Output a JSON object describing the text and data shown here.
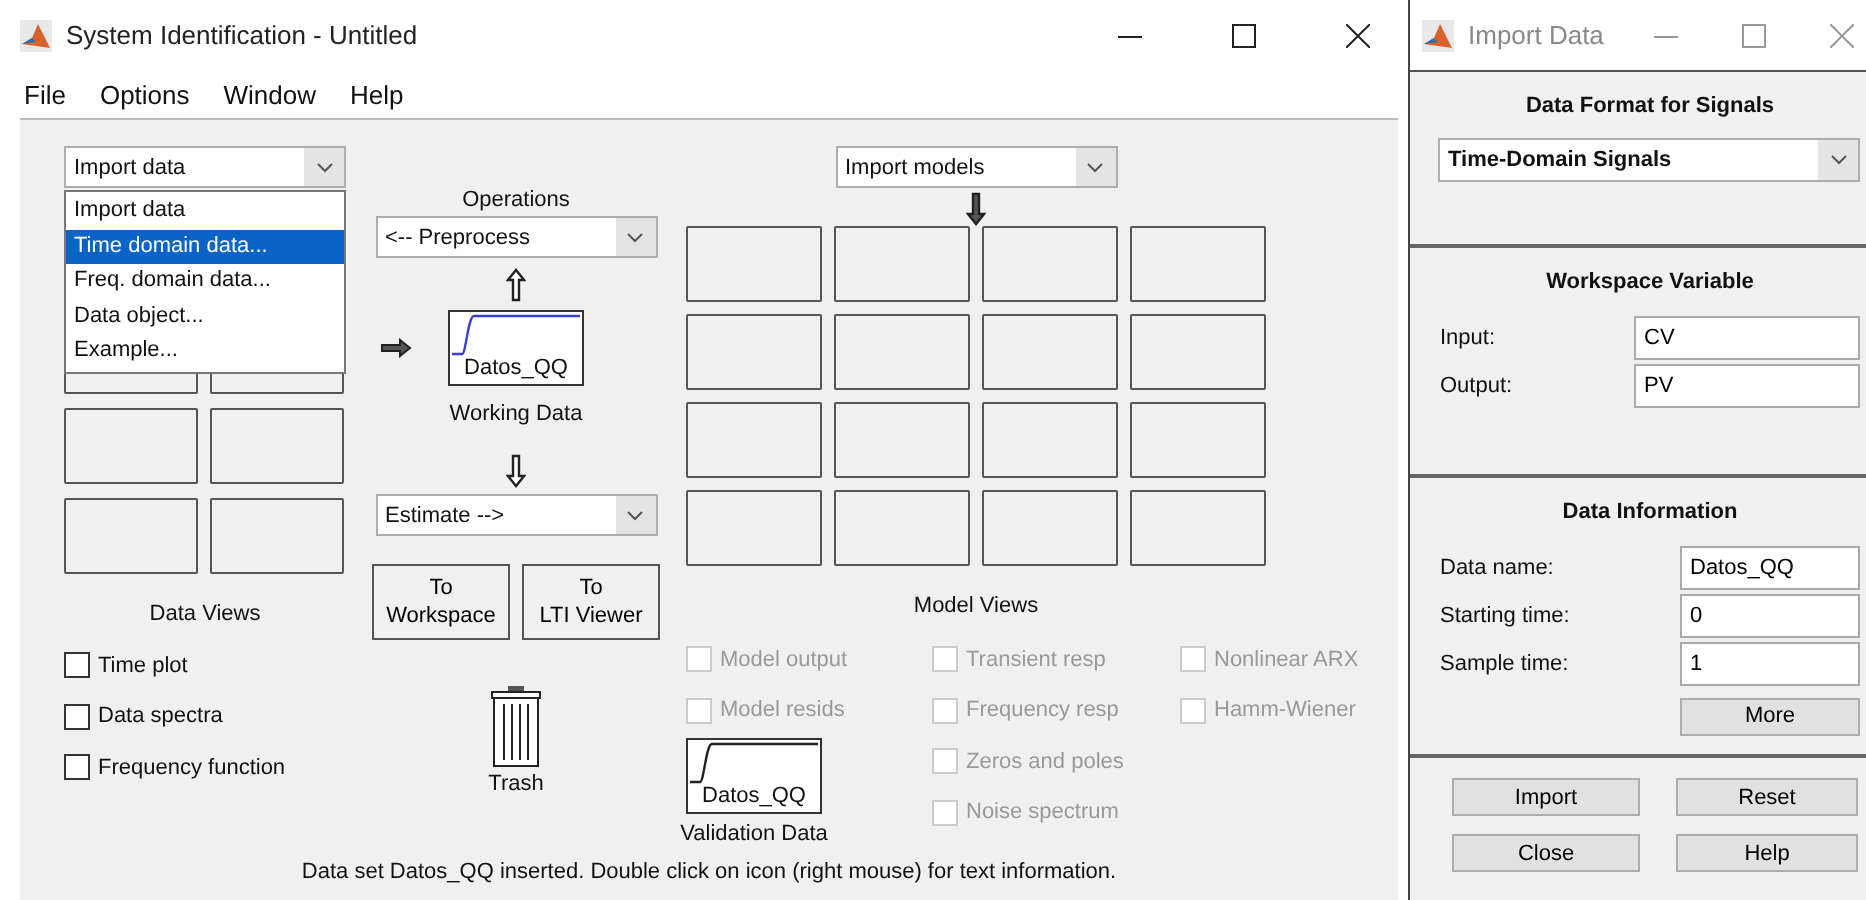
{
  "window": {
    "title": "System Identification - Untitled"
  },
  "menu": [
    "File",
    "Options",
    "Window",
    "Help"
  ],
  "data_views": {
    "dropdown": "Import data",
    "dropdown_menu": [
      {
        "label": "Import data",
        "selected": false
      },
      {
        "label": "Time domain data...",
        "selected": true
      },
      {
        "label": "Freq. domain data...",
        "selected": false
      },
      {
        "label": "Data object...",
        "selected": false
      },
      {
        "label": "Example...",
        "selected": false
      }
    ],
    "title": "Data Views",
    "checkboxes": [
      {
        "label": "Time plot",
        "checked": false,
        "disabled": false
      },
      {
        "label": "Data spectra",
        "checked": false,
        "disabled": false
      },
      {
        "label": "Frequency function",
        "checked": false,
        "disabled": false
      }
    ]
  },
  "operations": {
    "title": "Operations",
    "preprocess": "<-- Preprocess",
    "working_data": {
      "name": "Datos_QQ",
      "label": "Working Data"
    },
    "estimate": "Estimate -->",
    "buttons": [
      {
        "lines": [
          "To",
          "Workspace"
        ]
      },
      {
        "lines": [
          "To",
          "LTI Viewer"
        ]
      }
    ],
    "trash": "Trash"
  },
  "model_views": {
    "dropdown": "Import models",
    "title": "Model Views",
    "checkbox_columns": [
      [
        {
          "label": "Model output",
          "checked": false,
          "disabled": true
        },
        {
          "label": "Model resids",
          "checked": false,
          "disabled": true
        }
      ],
      [
        {
          "label": "Transient resp",
          "checked": false,
          "disabled": true
        },
        {
          "label": "Frequency resp",
          "checked": false,
          "disabled": true
        },
        {
          "label": "Zeros and poles",
          "checked": false,
          "disabled": true
        },
        {
          "label": "Noise spectrum",
          "checked": false,
          "disabled": true
        }
      ],
      [
        {
          "label": "Nonlinear ARX",
          "checked": false,
          "disabled": true
        },
        {
          "label": "Hamm-Wiener",
          "checked": false,
          "disabled": true
        }
      ]
    ],
    "validation_data": {
      "name": "Datos_QQ",
      "label": "Validation Data"
    }
  },
  "status_bar": "Data set Datos_QQ inserted.  Double click on icon (right mouse) for text information.",
  "import_dialog": {
    "title": "Import Data",
    "format": {
      "heading": "Data Format for Signals",
      "value": "Time-Domain Signals"
    },
    "workspace": {
      "heading": "Workspace Variable",
      "fields": [
        {
          "label": "Input:",
          "value": "CV"
        },
        {
          "label": "Output:",
          "value": "PV"
        }
      ]
    },
    "info": {
      "heading": "Data Information",
      "fields": [
        {
          "label": "Data name:",
          "value": "Datos_QQ"
        },
        {
          "label": "Starting time:",
          "value": "0"
        },
        {
          "label": "Sample time:",
          "value": "1"
        }
      ],
      "more": "More"
    },
    "buttons": [
      "Import",
      "Reset",
      "Close",
      "Help"
    ]
  }
}
